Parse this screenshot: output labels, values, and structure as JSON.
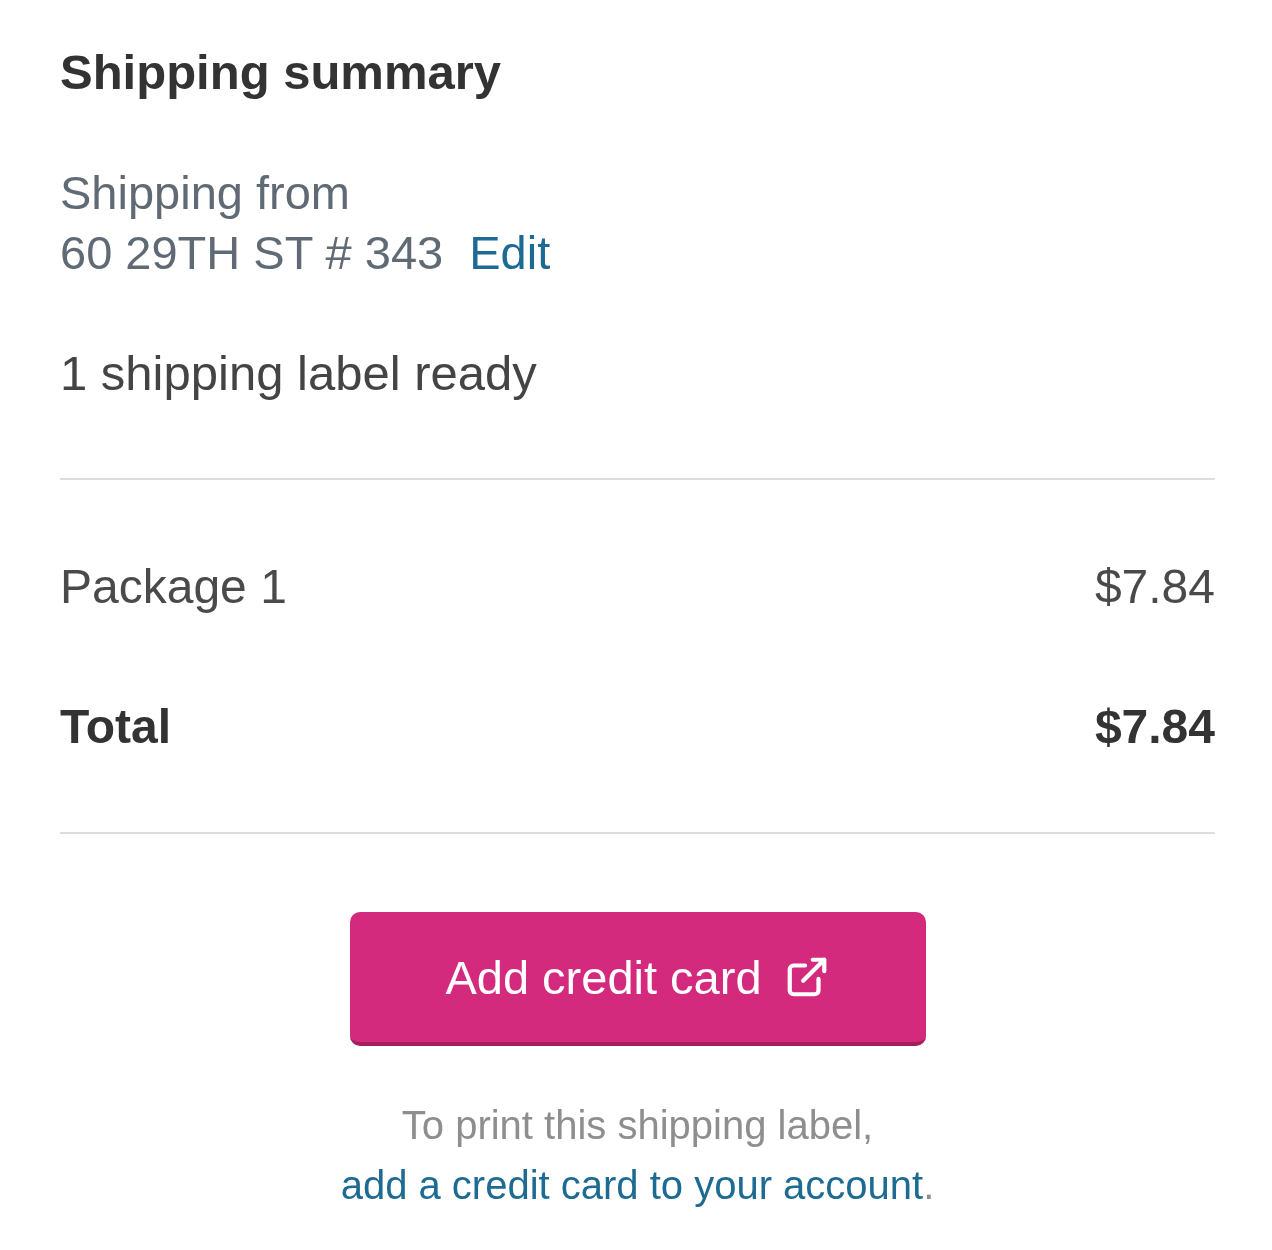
{
  "title": "Shipping summary",
  "origin": {
    "label": "Shipping from",
    "address": "60 29TH ST # 343",
    "edit_link": "Edit"
  },
  "label_status": "1 shipping label ready",
  "line_items": [
    {
      "kind": "item",
      "label": "Package 1",
      "amount": "$7.84"
    },
    {
      "kind": "total",
      "label": "Total",
      "amount": "$7.84"
    }
  ],
  "button": {
    "label": "Add credit card"
  },
  "note": {
    "text": "To print this shipping label,",
    "link": "add a credit card to your account",
    "end": "."
  }
}
